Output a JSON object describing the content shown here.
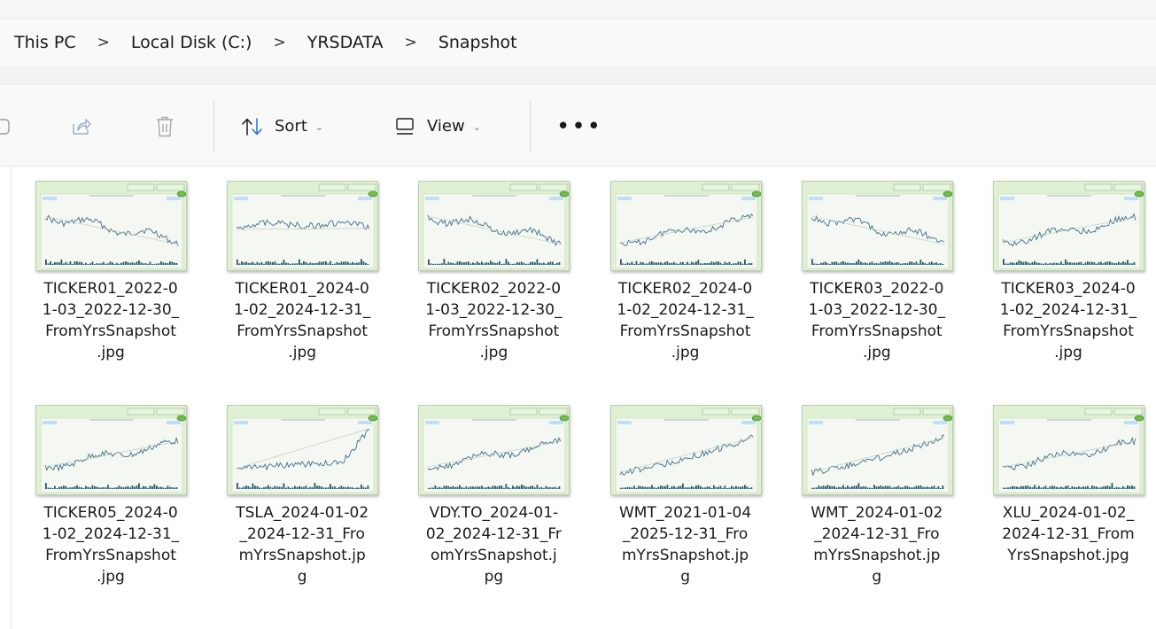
{
  "breadcrumb": {
    "items": [
      "This PC",
      "Local Disk (C:)",
      "YRSDATA",
      "Snapshot"
    ],
    "separator": ">"
  },
  "toolbar": {
    "sort_label": "Sort",
    "view_label": "View",
    "more_label": "•••"
  },
  "files": [
    {
      "lines": [
        "TICKER01_2022-0",
        "1-03_2022-12-30_",
        "FromYrsSnapshot",
        ".jpg"
      ],
      "trend": "down"
    },
    {
      "lines": [
        "TICKER01_2024-0",
        "1-02_2024-12-31_",
        "FromYrsSnapshot",
        ".jpg"
      ],
      "trend": "flat"
    },
    {
      "lines": [
        "TICKER02_2022-0",
        "1-03_2022-12-30_",
        "FromYrsSnapshot",
        ".jpg"
      ],
      "trend": "down"
    },
    {
      "lines": [
        "TICKER02_2024-0",
        "1-02_2024-12-31_",
        "FromYrsSnapshot",
        ".jpg"
      ],
      "trend": "up"
    },
    {
      "lines": [
        "TICKER03_2022-0",
        "1-03_2022-12-30_",
        "FromYrsSnapshot",
        ".jpg"
      ],
      "trend": "down"
    },
    {
      "lines": [
        "TICKER03_2024-0",
        "1-02_2024-12-31_",
        "FromYrsSnapshot",
        ".jpg"
      ],
      "trend": "up"
    },
    {
      "lines": [
        "TICKER05_2024-0",
        "1-02_2024-12-31_",
        "FromYrsSnapshot",
        ".jpg"
      ],
      "trend": "up"
    },
    {
      "lines": [
        "TSLA_2024-01-02",
        "_2024-12-31_Fro",
        "mYrsSnapshot.jp",
        "g"
      ],
      "trend": "spike"
    },
    {
      "lines": [
        "VDY.TO_2024-01-",
        "02_2024-12-31_Fr",
        "omYrsSnapshot.j",
        "pg"
      ],
      "trend": "up"
    },
    {
      "lines": [
        "WMT_2021-01-04",
        "_2025-12-31_Fro",
        "mYrsSnapshot.jp",
        "g"
      ],
      "trend": "strongup"
    },
    {
      "lines": [
        "WMT_2024-01-02",
        "_2024-12-31_Fro",
        "mYrsSnapshot.jp",
        "g"
      ],
      "trend": "strongup"
    },
    {
      "lines": [
        "XLU_2024-01-02_",
        "2024-12-31_From",
        "YrsSnapshot.jpg",
        ""
      ],
      "trend": "up"
    }
  ],
  "colors": {
    "thumb_bg": "#dff0d3",
    "chart_line": "#3f6f8c",
    "volume": "#1f5a74"
  }
}
